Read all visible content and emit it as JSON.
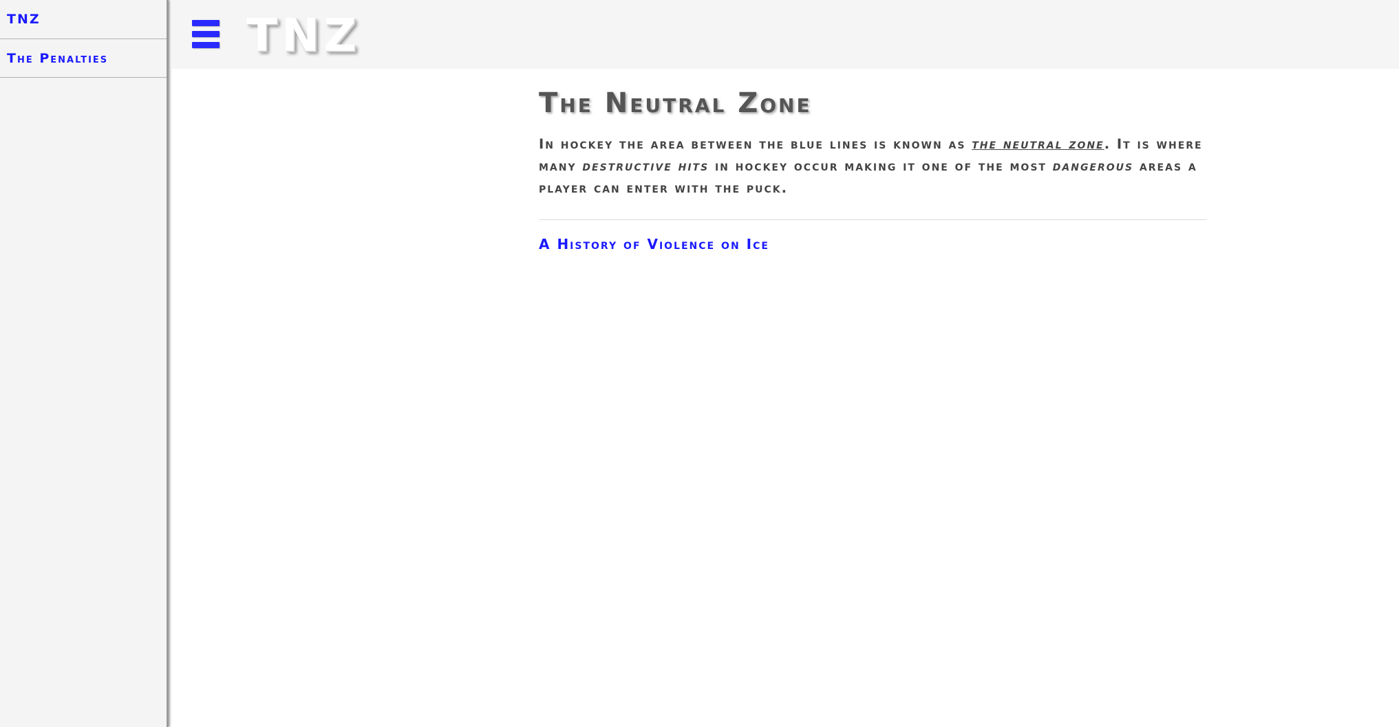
{
  "sidebar": {
    "items": [
      {
        "label": "TNZ"
      },
      {
        "label": "The Penalties"
      }
    ]
  },
  "header": {
    "menu_icon": "hamburger-menu-icon",
    "logo": "TNZ"
  },
  "main": {
    "title": "The Neutral Zone",
    "intro": {
      "p1": "In hockey the area between the blue lines is known as ",
      "em1": "the neutral zone",
      "p2": ". It is where many ",
      "em2": "destructive hits",
      "p3": " in hockey occur making it one of the most ",
      "em3": "dangerous",
      "p4": " areas a player can enter with the puck."
    },
    "link": "A History of Violence on Ice"
  },
  "colors": {
    "accent": "#2a2aff",
    "sidebar_bg": "#f4f4f4",
    "text": "#444444"
  }
}
